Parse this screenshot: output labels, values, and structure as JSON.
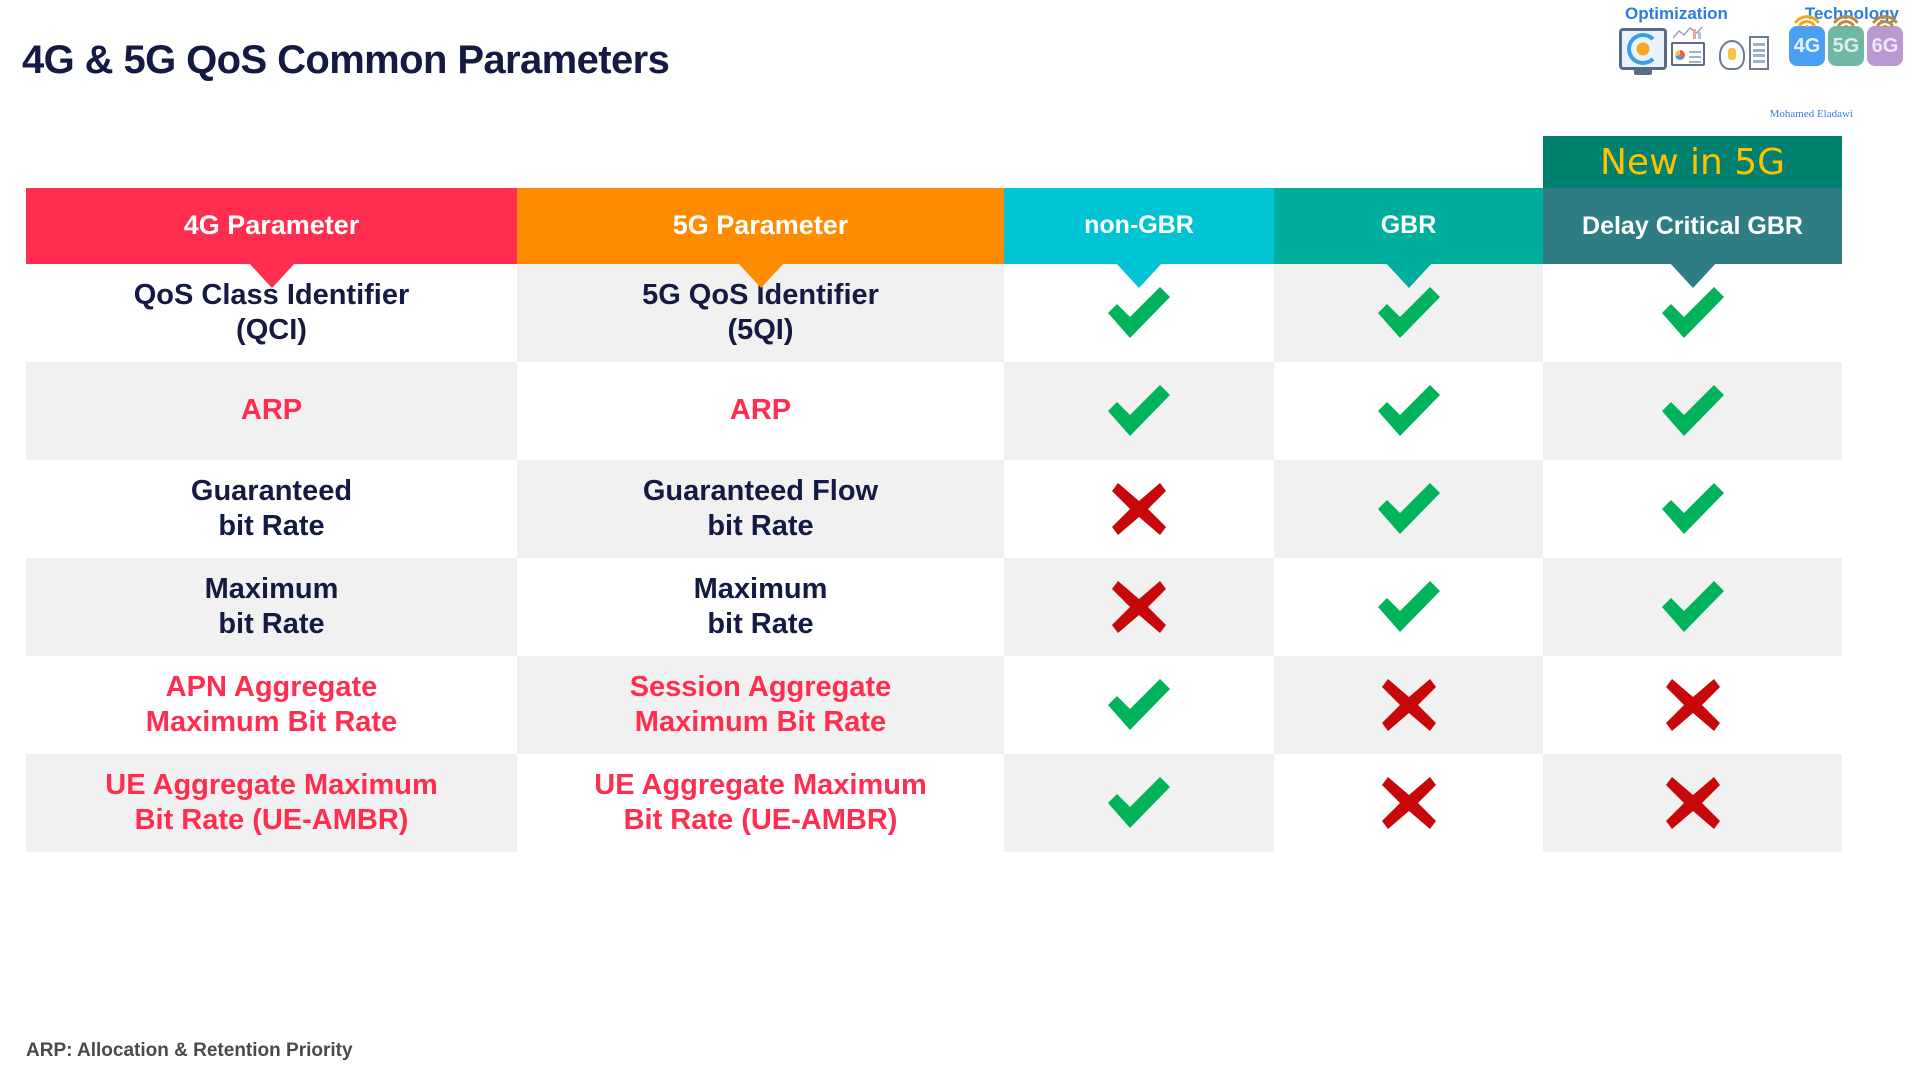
{
  "page": {
    "title": "4G & 5G QoS Common Parameters",
    "footnote": "ARP: Allocation & Retention Priority",
    "background": "#ffffff"
  },
  "brand": {
    "label_left": "Optimization",
    "label_right": "Technology",
    "author": "Mohamed Eladawi",
    "label_color": "#2b7de0",
    "tiles": [
      "4G",
      "5G",
      "6G"
    ]
  },
  "table": {
    "badge": {
      "text": "New in 5G",
      "background": "#00806e",
      "color": "#ffc000"
    },
    "headers": [
      {
        "label": "4G Parameter",
        "background": "#ff2d4f"
      },
      {
        "label": "5G Parameter",
        "background": "#ff8c00"
      },
      {
        "label": "non-GBR",
        "background": "#00c4d4"
      },
      {
        "label": "GBR",
        "background": "#00ae9d"
      },
      {
        "label": "Delay Critical GBR",
        "background": "#2e7c84"
      }
    ],
    "colors": {
      "check": "#00b35a",
      "cross": "#c8070b",
      "text_navy": "#141a42",
      "text_pink": "#ff2d4f",
      "shade": "#f1f1f1"
    },
    "rows": [
      {
        "param_4g": "QoS Class Identifier\n(QCI)",
        "param_4g_l1": "QoS Class Identifier",
        "param_4g_l2": "(QCI)",
        "param_5g_l1": "5G QoS Identifier",
        "param_5g_l2": "(5QI)",
        "style": "navy",
        "non_gbr": "check",
        "gbr": "check",
        "delay_critical_gbr": "check"
      },
      {
        "param_4g_l1": "ARP",
        "param_4g_l2": "",
        "param_5g_l1": "ARP",
        "param_5g_l2": "",
        "style": "pink",
        "non_gbr": "check",
        "gbr": "check",
        "delay_critical_gbr": "check"
      },
      {
        "param_4g_l1": "Guaranteed",
        "param_4g_l2": "bit Rate",
        "param_5g_l1": "Guaranteed Flow",
        "param_5g_l2": "bit Rate",
        "style": "navy",
        "non_gbr": "cross",
        "gbr": "check",
        "delay_critical_gbr": "check"
      },
      {
        "param_4g_l1": "Maximum",
        "param_4g_l2": "bit Rate",
        "param_5g_l1": "Maximum",
        "param_5g_l2": "bit Rate",
        "style": "navy",
        "non_gbr": "cross",
        "gbr": "check",
        "delay_critical_gbr": "check"
      },
      {
        "param_4g_l1": "APN Aggregate",
        "param_4g_l2": "Maximum Bit Rate",
        "param_5g_l1": "Session Aggregate",
        "param_5g_l2": "Maximum Bit Rate",
        "style": "pink",
        "non_gbr": "check",
        "gbr": "cross",
        "delay_critical_gbr": "cross"
      },
      {
        "param_4g_l1": "UE Aggregate Maximum",
        "param_4g_l2": "Bit Rate (UE-AMBR)",
        "param_5g_l1": "UE Aggregate Maximum",
        "param_5g_l2": "Bit Rate (UE-AMBR)",
        "style": "pink",
        "non_gbr": "check",
        "gbr": "cross",
        "delay_critical_gbr": "cross"
      }
    ]
  }
}
